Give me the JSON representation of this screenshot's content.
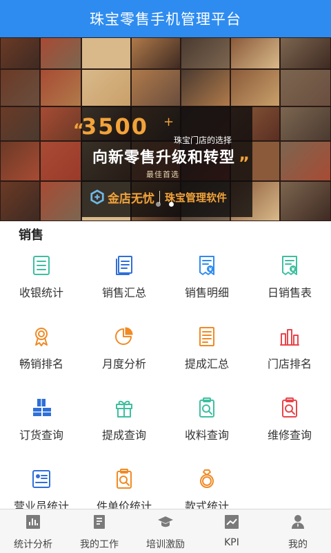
{
  "header": {
    "title": "珠宝零售手机管理平台"
  },
  "banner": {
    "number": "3500",
    "plus": "+",
    "tagline": "珠宝门店的选择",
    "slogan": "向新零售升级和转型",
    "best_choice": "最佳首选",
    "brand": "金店无忧",
    "product": "珠宝管理软件",
    "quote_left": "“",
    "quote_right": "”",
    "slides": 2,
    "active_slide": 2
  },
  "section": {
    "title": "销售"
  },
  "menu": [
    {
      "label": "收银统计",
      "icon": "list-icon",
      "color": "#3dbfa0"
    },
    {
      "label": "销售汇总",
      "icon": "document-stack-icon",
      "color": "#2e6fd8"
    },
    {
      "label": "销售明细",
      "icon": "receipt-yen-icon",
      "color": "#2e8cf0"
    },
    {
      "label": "日销售表",
      "icon": "receipt-yen-icon",
      "color": "#3dbfa0"
    },
    {
      "label": "畅销排名",
      "icon": "award-ribbon-icon",
      "color": "#f08a24"
    },
    {
      "label": "月度分析",
      "icon": "pie-chart-icon",
      "color": "#f08a24"
    },
    {
      "label": "提成汇总",
      "icon": "document-lines-icon",
      "color": "#f08a24"
    },
    {
      "label": "门店排名",
      "icon": "bar-chart-icon",
      "color": "#e8454a"
    },
    {
      "label": "订货查询",
      "icon": "boxes-icon",
      "color": "#2e6fd8"
    },
    {
      "label": "提成查询",
      "icon": "gift-icon",
      "color": "#3dbfa0"
    },
    {
      "label": "收料查询",
      "icon": "clipboard-search-icon",
      "color": "#3dbfa0"
    },
    {
      "label": "维修查询",
      "icon": "clipboard-search-icon",
      "color": "#e8454a"
    },
    {
      "label": "营业员统计",
      "icon": "id-card-icon",
      "color": "#2e6fd8"
    },
    {
      "label": "件单价统计",
      "icon": "clipboard-search-icon",
      "color": "#f08a24"
    },
    {
      "label": "款式统计",
      "icon": "ring-icon",
      "color": "#f08a24"
    }
  ],
  "tabbar": [
    {
      "label": "统计分析",
      "icon": "stats-icon"
    },
    {
      "label": "我的工作",
      "icon": "work-doc-icon"
    },
    {
      "label": "培训激励",
      "icon": "graduation-cap-icon"
    },
    {
      "label": "KPI",
      "icon": "kpi-chart-icon"
    },
    {
      "label": "我的",
      "icon": "user-icon"
    }
  ],
  "colors": {
    "header_bg": "#2e8cf0",
    "banner_accent": "#f2a33a",
    "tabbar_bg": "#f6f6f6",
    "tab_icon": "#7a7a7a"
  }
}
